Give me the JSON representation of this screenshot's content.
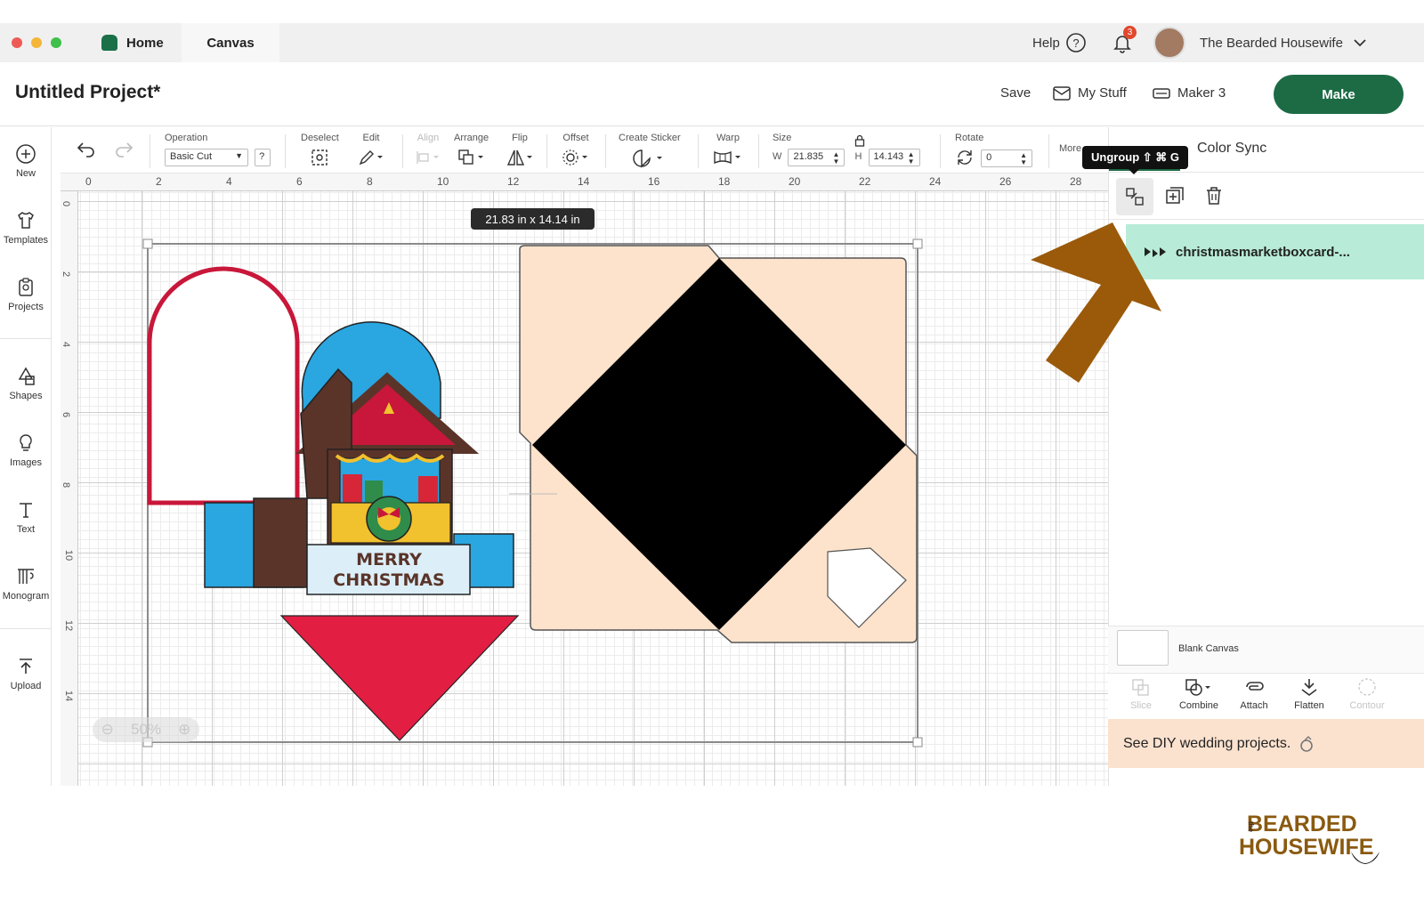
{
  "window": {
    "tabs": [
      {
        "label": "Home"
      },
      {
        "label": "Canvas"
      }
    ],
    "help_label": "Help",
    "notification_count": "3",
    "user_name": "The Bearded Housewife"
  },
  "titlebar": {
    "project_title": "Untitled Project*",
    "save_label": "Save",
    "my_stuff_label": "My Stuff",
    "machine_label": "Maker 3",
    "make_label": "Make"
  },
  "sidebar": {
    "items": [
      {
        "label": "New",
        "icon": "plus-circle-icon"
      },
      {
        "label": "Templates",
        "icon": "shirt-icon"
      },
      {
        "label": "Projects",
        "icon": "clipboard-icon"
      },
      {
        "label": "Shapes",
        "icon": "shapes-icon"
      },
      {
        "label": "Images",
        "icon": "lightbulb-icon"
      },
      {
        "label": "Text",
        "icon": "text-icon"
      },
      {
        "label": "Monogram",
        "icon": "monogram-icon"
      },
      {
        "label": "Upload",
        "icon": "upload-icon"
      }
    ]
  },
  "toolbar": {
    "operation_label": "Operation",
    "operation_value": "Basic Cut",
    "deselect_label": "Deselect",
    "edit_label": "Edit",
    "align_label": "Align",
    "arrange_label": "Arrange",
    "flip_label": "Flip",
    "offset_label": "Offset",
    "create_sticker_label": "Create Sticker",
    "warp_label": "Warp",
    "size_label": "Size",
    "w_label": "W",
    "w_value": "21.835",
    "h_label": "H",
    "h_value": "14.143",
    "rotate_label": "Rotate",
    "rotate_value": "0",
    "more_label": "More"
  },
  "ruler": {
    "top_ticks": [
      "0",
      "2",
      "4",
      "6",
      "8",
      "10",
      "12",
      "14",
      "16",
      "18",
      "20",
      "22",
      "24",
      "26",
      "28"
    ],
    "left_ticks": [
      "0",
      "2",
      "4",
      "6",
      "8",
      "10",
      "12",
      "14"
    ]
  },
  "canvas": {
    "size_badge": "21.83  in x 14.14  in",
    "zoom_label": "50%",
    "card_text_line1": "MERRY",
    "card_text_line2": "CHRISTMAS"
  },
  "right_panel": {
    "tooltip": "Ungroup ⇧ ⌘ G",
    "color_sync_label": "Color Sync",
    "layer_name": "christmasmarketboxcard-...",
    "blank_canvas_label": "Blank Canvas",
    "tools": [
      {
        "label": "Slice",
        "enabled": false
      },
      {
        "label": "Combine",
        "enabled": true
      },
      {
        "label": "Attach",
        "enabled": true
      },
      {
        "label": "Flatten",
        "enabled": true
      },
      {
        "label": "Contour",
        "enabled": false
      }
    ],
    "promo_text": "See DIY wedding projects."
  },
  "watermark": {
    "brand_small": "the",
    "brand_line1": "BEARDED",
    "brand_line2": "HOUSEWIFE"
  },
  "colors": {
    "brand_green": "#1c6b45",
    "layer_highlight": "#b8ecd8",
    "arrow_brown": "#9a5a0a",
    "promo_bg": "#fbe2cf"
  }
}
